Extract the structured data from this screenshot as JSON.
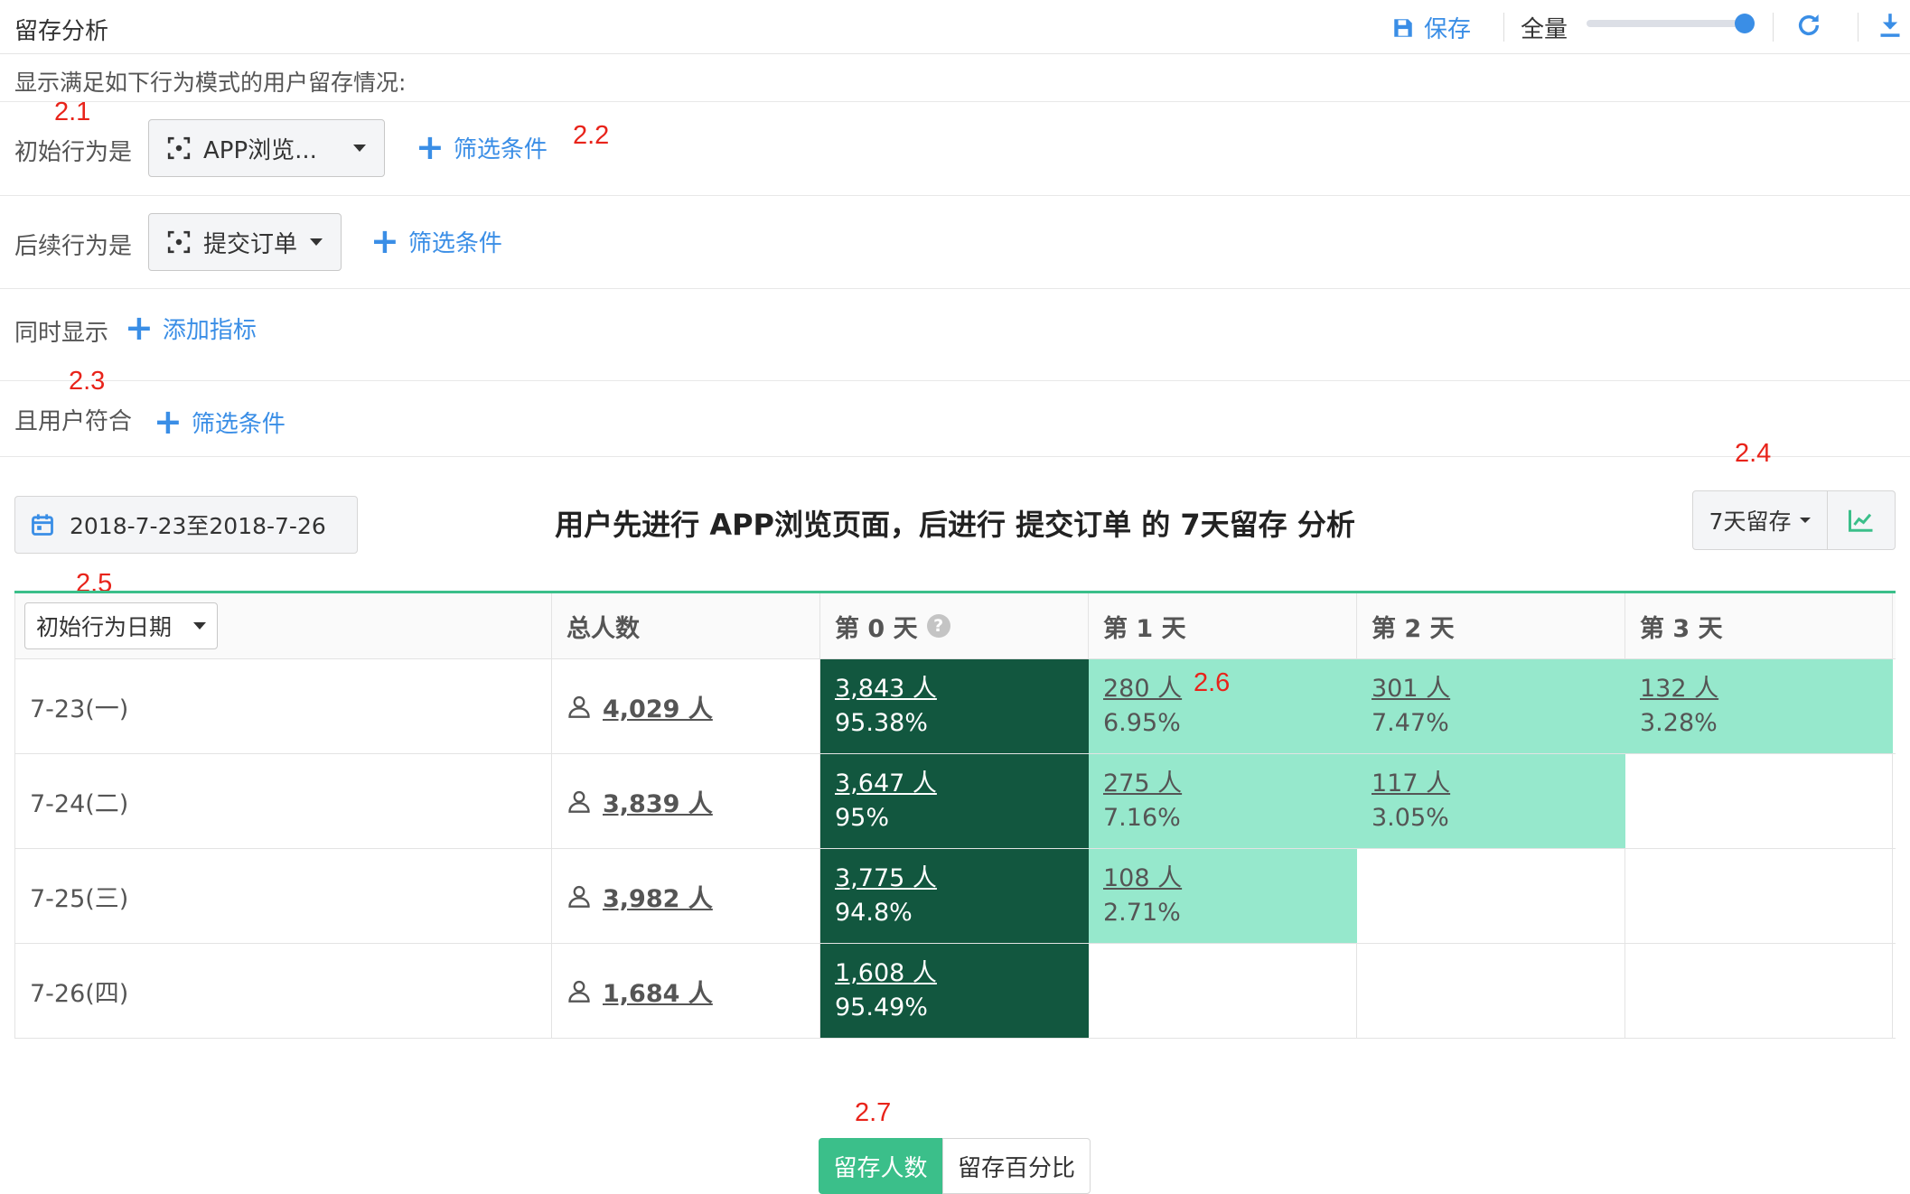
{
  "header": {
    "title": "留存分析",
    "save_label": "保存",
    "scope_label": "全量"
  },
  "description": "显示满足如下行为模式的用户留存情况:",
  "conditions": {
    "initial": {
      "label": "初始行为是",
      "value": "APP浏览...",
      "filter_label": "筛选条件"
    },
    "followup": {
      "label": "后续行为是",
      "value": "提交订单",
      "filter_label": "筛选条件"
    },
    "also_show": {
      "label": "同时显示",
      "add_label": "添加指标"
    },
    "user_match": {
      "label": "且用户符合",
      "filter_label": "筛选条件"
    }
  },
  "toolbar": {
    "date_range": "2018-7-23至2018-7-26",
    "report_title": "用户先进行 APP浏览页面，后进行 提交订单 的 7天留存 分析",
    "retention_select": "7天留存"
  },
  "annotations": [
    "2.1",
    "2.2",
    "2.3",
    "2.4",
    "2.5",
    "2.6",
    "2.7"
  ],
  "table": {
    "group_select": "初始行为日期",
    "headers": [
      "总人数",
      "第 0 天",
      "第 1 天",
      "第 2 天",
      "第 3 天"
    ],
    "rows": [
      {
        "date": "7-23(一)",
        "total": "4,029 人",
        "days": [
          {
            "count": "3,843 人",
            "pct": "95.38%"
          },
          {
            "count": "280 人",
            "pct": "6.95%"
          },
          {
            "count": "301 人",
            "pct": "7.47%"
          },
          {
            "count": "132 人",
            "pct": "3.28%"
          }
        ]
      },
      {
        "date": "7-24(二)",
        "total": "3,839 人",
        "days": [
          {
            "count": "3,647 人",
            "pct": "95%"
          },
          {
            "count": "275 人",
            "pct": "7.16%"
          },
          {
            "count": "117 人",
            "pct": "3.05%"
          }
        ]
      },
      {
        "date": "7-25(三)",
        "total": "3,982 人",
        "days": [
          {
            "count": "3,775 人",
            "pct": "94.8%"
          },
          {
            "count": "108 人",
            "pct": "2.71%"
          }
        ]
      },
      {
        "date": "7-26(四)",
        "total": "1,684 人",
        "days": [
          {
            "count": "1,608 人",
            "pct": "95.49%"
          }
        ]
      }
    ]
  },
  "bottom_toggle": {
    "count_label": "留存人数",
    "percent_label": "留存百分比"
  },
  "colors": {
    "accent": "#3a8ee6",
    "green": "#3bbf8a",
    "dark_cell": "#12573f",
    "light_cell": "#96e8cc",
    "annotation": "#e8231a"
  }
}
